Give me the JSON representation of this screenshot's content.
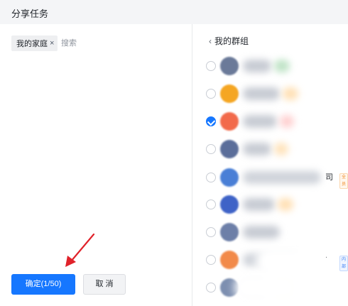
{
  "dialog": {
    "title": "分享任务"
  },
  "selection": {
    "tag_label": "我的家庭",
    "tag_close": "×",
    "search_placeholder": "搜索"
  },
  "buttons": {
    "confirm_label": "确定(1/50)",
    "cancel_label": "取 消"
  },
  "group_list": {
    "back_chevron": "‹",
    "title": "我的群组",
    "rows": [
      {
        "checked": false,
        "avatar_color": "#6b7a99",
        "suffix": "",
        "badge": ""
      },
      {
        "checked": false,
        "avatar_color": "#f5a623",
        "suffix": "",
        "badge": ""
      },
      {
        "checked": true,
        "avatar_color": "#f26a4b",
        "suffix": "",
        "badge": ""
      },
      {
        "checked": false,
        "avatar_color": "#5b6e9a",
        "suffix": "",
        "badge": ""
      },
      {
        "checked": false,
        "avatar_color": "#4a7fd6",
        "suffix": "司",
        "badge": "全员"
      },
      {
        "checked": false,
        "avatar_color": "#3f63c7",
        "suffix": "",
        "badge": ""
      },
      {
        "checked": false,
        "avatar_color": "#6d7fa8",
        "suffix": "",
        "badge": ""
      },
      {
        "checked": false,
        "avatar_color": "#f28a4a",
        "suffix": ".",
        "badge": "内部"
      },
      {
        "checked": false,
        "avatar_color": "#7d8fb0",
        "suffix": "",
        "badge": ""
      }
    ]
  },
  "colors": {
    "primary": "#1677ff",
    "header_bg": "#f4f5f7",
    "annotation_arrow": "#e0222a"
  }
}
